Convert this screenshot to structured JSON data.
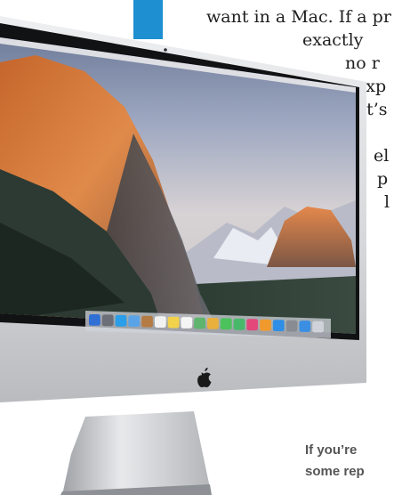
{
  "article": {
    "lines": [
      "want in a Mac. If a pr",
      "exactly",
      "no r",
      "exp",
      "it’s",
      "el",
      "p",
      "l"
    ],
    "caption_lines": [
      "If you’re",
      "some rep"
    ]
  },
  "product_image": {
    "subject": "iMac",
    "wallpaper": "El Capitan mountain landscape",
    "logo": "apple-logo-icon",
    "dock_icons": [
      "finder-icon",
      "launchpad-icon",
      "safari-icon",
      "mail-icon",
      "contacts-icon",
      "calendar-icon",
      "notes-icon",
      "reminders-icon",
      "maps-icon",
      "photos-icon",
      "messages-icon",
      "facetime-icon",
      "itunes-icon",
      "ibooks-icon",
      "app-store-icon",
      "system-preferences-icon",
      "folder-icon",
      "trash-icon"
    ]
  },
  "colors": {
    "accent_bar": "#1e8fd0",
    "body_text": "#1f1f1f",
    "caption_text": "#555555",
    "aluminium": "#d9dadc",
    "bezel": "#111214"
  }
}
